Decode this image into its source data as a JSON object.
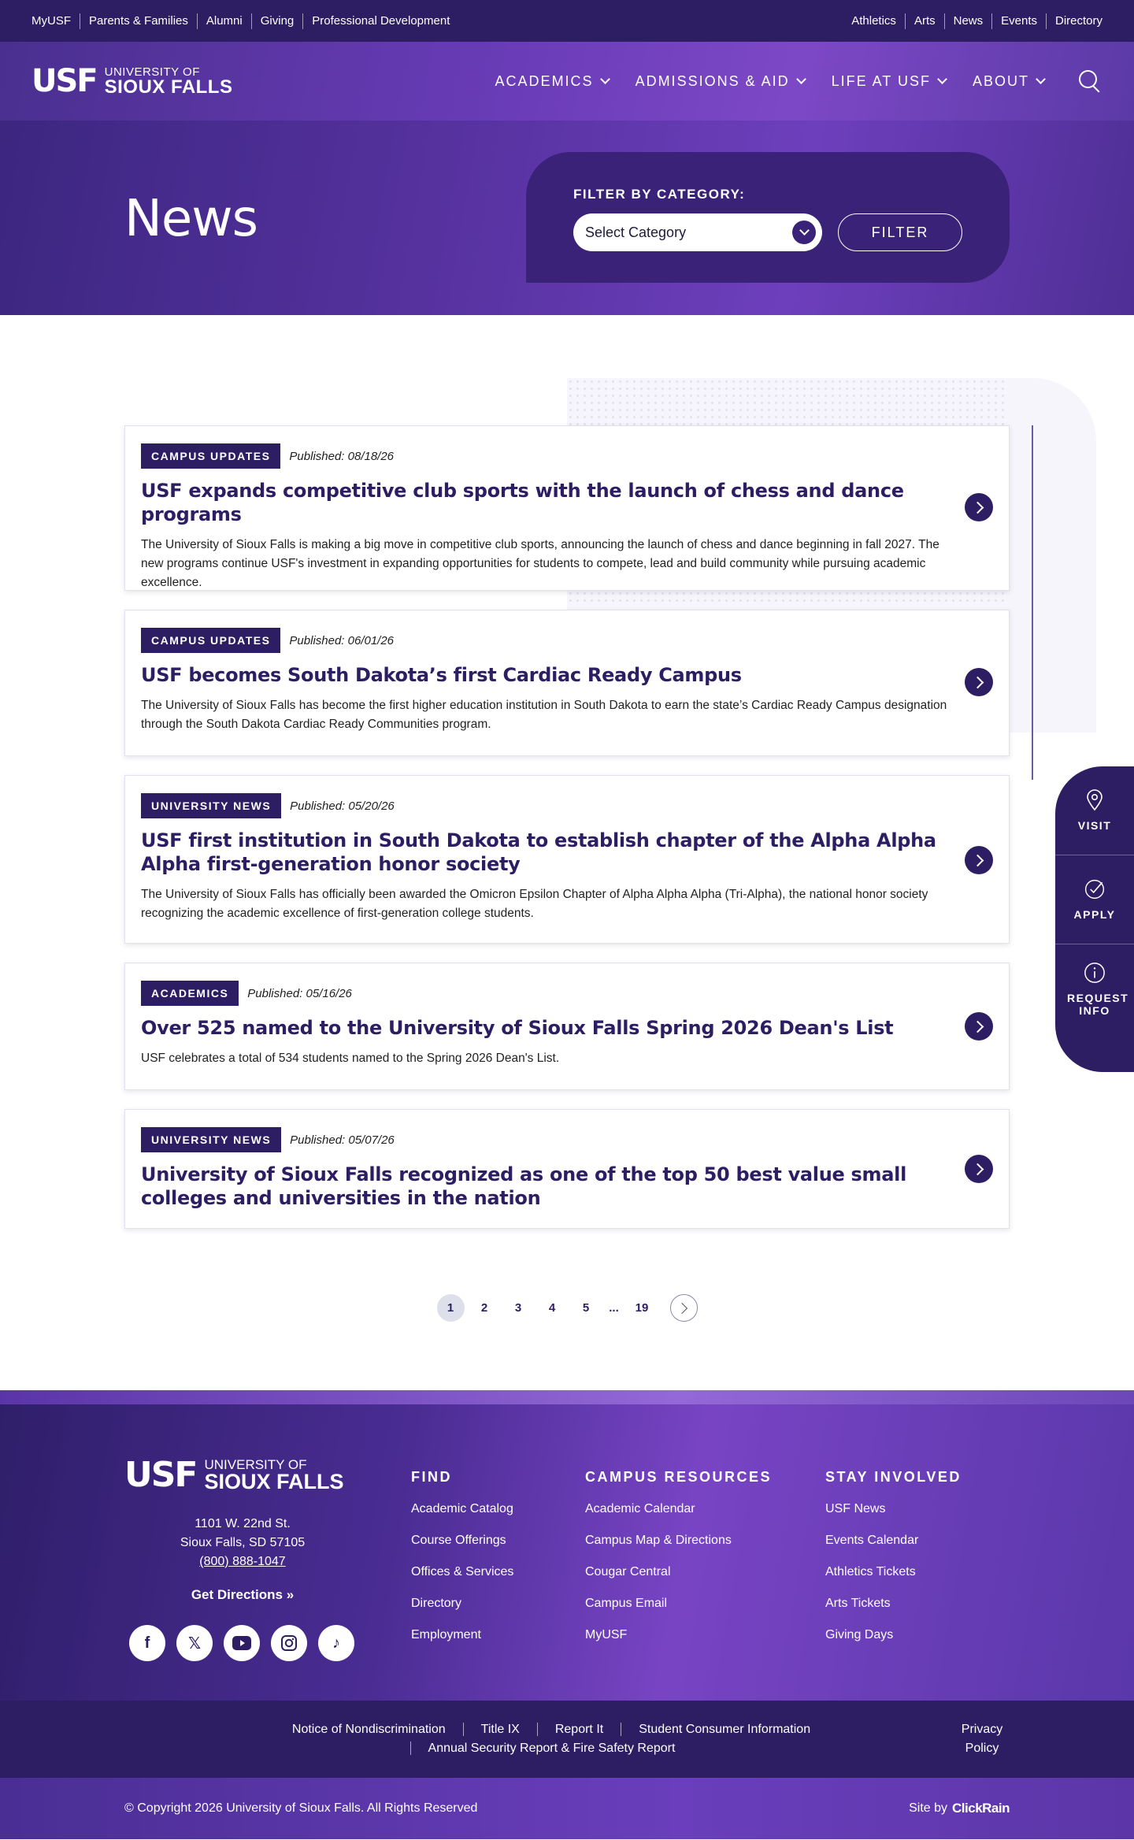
{
  "utility": {
    "left": [
      "MyUSF",
      "Parents & Families",
      "Alumni",
      "Giving",
      "Professional Development"
    ],
    "right": [
      "Athletics",
      "Arts",
      "News",
      "Events",
      "Directory"
    ]
  },
  "logo": {
    "mark": "USF",
    "line1": "UNIVERSITY OF",
    "line2": "SIOUX FALLS"
  },
  "nav": [
    "ACADEMICS",
    "ADMISSIONS & AID",
    "LIFE AT USF",
    "ABOUT"
  ],
  "hero": {
    "title": "News",
    "filter_label": "FILTER BY CATEGORY:",
    "select_value": "Select Category",
    "filter_button": "FILTER"
  },
  "articles": [
    {
      "category": "CAMPUS UPDATES",
      "published": "Published: 08/18/26",
      "title": "USF expands competitive club sports with the launch of chess and dance programs",
      "summary": "The University of Sioux Falls is making a big move in competitive club sports, announcing the launch of chess and dance beginning in fall 2027. The new programs continue USF's investment in expanding opportunities for students to compete, lead and build community while pursuing academic excellence."
    },
    {
      "category": "CAMPUS UPDATES",
      "published": "Published: 06/01/26",
      "title": "USF becomes South Dakota’s first Cardiac Ready Campus",
      "summary": "The University of Sioux Falls has become the first higher education institution in South Dakota to earn the state’s Cardiac Ready Campus designation through the South Dakota Cardiac Ready Communities program."
    },
    {
      "category": "UNIVERSITY NEWS",
      "published": "Published: 05/20/26",
      "title": "USF first institution in South Dakota to establish chapter of the Alpha Alpha Alpha first-generation honor society",
      "summary": "The University of Sioux Falls has officially been awarded the Omicron Epsilon Chapter of Alpha Alpha Alpha (Tri-Alpha), the national honor society recognizing the academic excellence of first-generation college students."
    },
    {
      "category": "ACADEMICS",
      "published": "Published: 05/16/26",
      "title": "Over 525 named to the University of Sioux Falls Spring 2026 Dean's List",
      "summary": "USF celebrates a total of 534 students named to the Spring 2026 Dean's List."
    },
    {
      "category": "UNIVERSITY NEWS",
      "published": "Published: 05/07/26",
      "title": "University of Sioux Falls recognized as one of the top 50 best value small colleges and universities in the nation",
      "summary": ""
    }
  ],
  "pagination": {
    "pages": [
      "1",
      "2",
      "3",
      "4",
      "5",
      "...",
      "19"
    ],
    "current": "1"
  },
  "side_cta": [
    "VISIT",
    "APPLY",
    "REQUEST INFO"
  ],
  "footer": {
    "address1": "1101 W. 22nd St.",
    "address2": "Sioux Falls, SD 57105",
    "phone": "(800) 888-1047",
    "directions": "Get Directions »",
    "social": [
      "facebook-icon",
      "x-icon",
      "youtube-icon",
      "instagram-icon",
      "tiktok-icon"
    ],
    "columns": [
      {
        "title": "FIND",
        "links": [
          "Academic Catalog",
          "Course Offerings",
          "Offices & Services",
          "Directory",
          "Employment"
        ]
      },
      {
        "title": "CAMPUS RESOURCES",
        "links": [
          "Academic Calendar",
          "Campus Map & Directions",
          "Cougar Central",
          "Campus Email",
          "MyUSF"
        ]
      },
      {
        "title": "STAY INVOLVED",
        "links": [
          "USF News",
          "Events Calendar",
          "Athletics Tickets",
          "Arts Tickets",
          "Giving Days"
        ]
      }
    ],
    "legal_links": [
      "Notice of Nondiscrimination",
      "Title IX",
      "Report It",
      "Student Consumer Information",
      "Annual Security Report & Fire Safety Report"
    ],
    "privacy": "Privacy Policy",
    "copyright": "© Copyright 2026 University of Sioux Falls. All Rights Reserved",
    "site_by": "Site by",
    "agency": "ClickRain"
  },
  "colors": {
    "primary": "#2d1e63",
    "accent": "#7844c4"
  }
}
